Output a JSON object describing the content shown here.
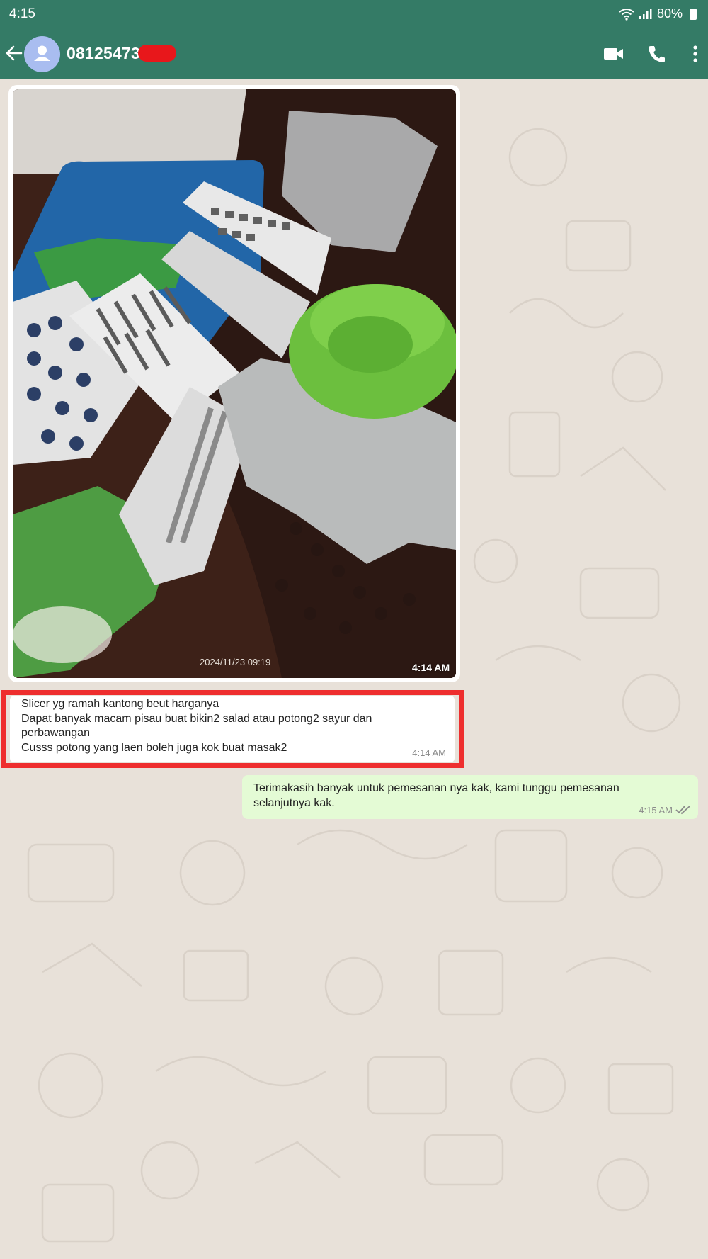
{
  "status_bar": {
    "time": "4:15",
    "battery": "80%"
  },
  "header": {
    "contact_name": "081254730",
    "icons": [
      "back-arrow-icon",
      "avatar-icon",
      "video-call-icon",
      "phone-icon",
      "more-options-icon"
    ]
  },
  "messages": [
    {
      "type": "image",
      "direction": "incoming",
      "photo_stamp": "2024/11/23 09:19",
      "time": "4:14 AM"
    },
    {
      "type": "text",
      "direction": "incoming",
      "lines": [
        "Slicer yg ramah kantong beut harganya",
        "Dapat banyak macam pisau buat bikin2 salad atau potong2 sayur dan",
        "perbawangan",
        "Cusss potong yang laen boleh juga kok buat masak2"
      ],
      "time": "4:14 AM"
    },
    {
      "type": "text",
      "direction": "outgoing",
      "lines": [
        "Terimakasih banyak untuk pemesanan nya kak, kami tunggu pemesanan",
        "selanjutnya kak."
      ],
      "time": "4:15 AM",
      "status": "read"
    }
  ],
  "colors": {
    "header": "#347b66",
    "wallpaper": "#e8e1d9",
    "outgoing_bubble": "#e4fbd5",
    "highlight": "#ee2e2e"
  }
}
